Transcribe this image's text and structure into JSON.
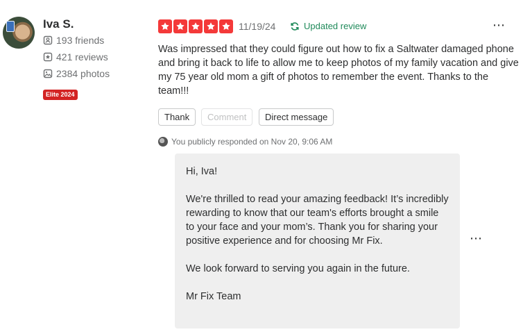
{
  "user": {
    "name": "Iva S.",
    "friends": "193 friends",
    "reviews": "421 reviews",
    "photos": "2384 photos",
    "elite_badge": "Elite 2024"
  },
  "review": {
    "rating": 5,
    "rating_color": "#f43939",
    "date": "11/19/24",
    "updated_label": "Updated review",
    "text": "Was impressed that they could figure out how to fix a Saltwater damaged phone and bring it back to life to allow me to keep photos of my family vacation and give my 75 year old mom a gift of photos to remember the event. Thanks to the team!!!",
    "more_icon": "⋯"
  },
  "actions": {
    "thank": "Thank",
    "comment": "Comment",
    "direct_message": "Direct message"
  },
  "response": {
    "header": "You publicly responded on Nov 20, 9:06 AM",
    "greeting": "Hi, Iva!",
    "paragraph1": "We're thrilled to read your amazing feedback! It’s incredibly rewarding to know that our team's efforts brought a smile to your face and your mom’s. Thank you for sharing your positive experience and for choosing Mr Fix.",
    "paragraph2": "We look forward to serving you again in the future.",
    "signature": "Mr Fix Team",
    "more_icon": "⋯"
  }
}
